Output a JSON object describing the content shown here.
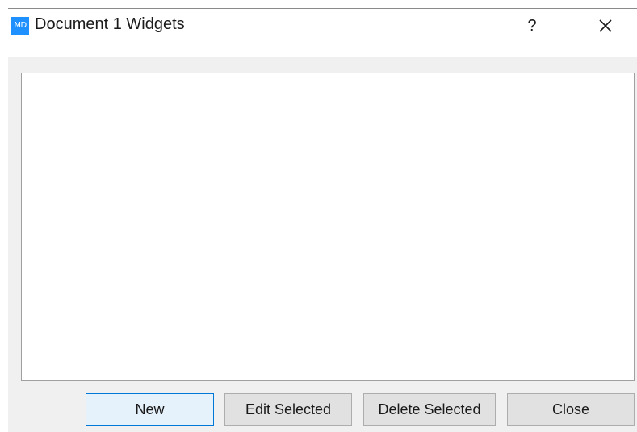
{
  "window": {
    "title": "Document 1 Widgets",
    "icon_text": "MD",
    "icon_color": "#1e90ff",
    "help_label": "?",
    "close_icon": "close-icon"
  },
  "listbox": {
    "items": []
  },
  "buttons": {
    "new_label": "New",
    "edit_label": "Edit Selected",
    "delete_label": "Delete Selected",
    "close_label": "Close"
  }
}
